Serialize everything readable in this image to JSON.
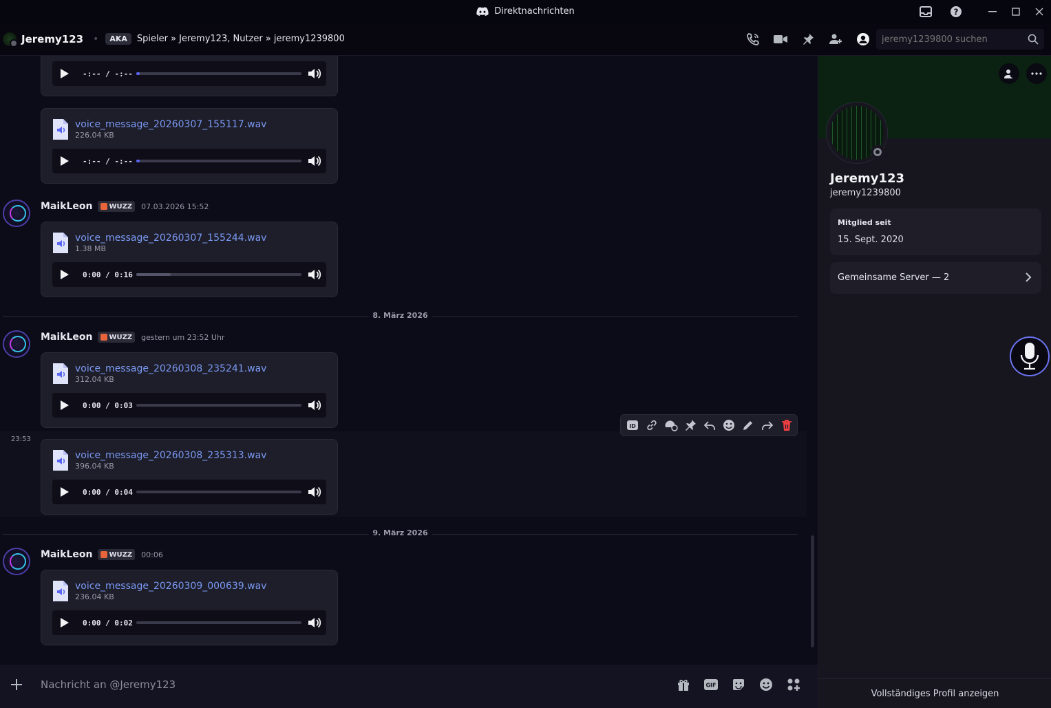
{
  "window": {
    "title": "Direktnachrichten"
  },
  "header": {
    "username": "Jeremy123",
    "aka_badge": "AKA",
    "aka_text": "Spieler » Jeremy123, Nutzer » jeremy1239800",
    "search_placeholder": "jeremy1239800 suchen"
  },
  "messages": {
    "m0": {
      "size": "",
      "time": "-:-- / -:--",
      "progress": 0.02
    },
    "m1": {
      "file": "voice_message_20260307_155117.wav",
      "size": "226.04 KB",
      "time": "-:-- / -:--",
      "progress": 0.02
    },
    "g1": {
      "author": "MaikLeon",
      "tag": "WUZZ",
      "timestamp": "07.03.2026 15:52"
    },
    "m2": {
      "file": "voice_message_20260307_155244.wav",
      "size": "1.38 MB",
      "time": "0:00 / 0:16",
      "progress": 0.0,
      "buffered": 0.21
    },
    "d1": "8. März 2026",
    "g2": {
      "author": "MaikLeon",
      "tag": "WUZZ",
      "timestamp": "gestern um 23:52 Uhr"
    },
    "m3": {
      "file": "voice_message_20260308_235241.wav",
      "size": "312.04 KB",
      "time": "0:00 / 0:03",
      "progress": 0.0
    },
    "hover_time": "23:53",
    "m4": {
      "file": "voice_message_20260308_235313.wav",
      "size": "396.04 KB",
      "time": "0:00 / 0:04",
      "progress": 0.0
    },
    "d2": "9. März 2026",
    "g3": {
      "author": "MaikLeon",
      "tag": "WUZZ",
      "timestamp": "00:06"
    },
    "m5": {
      "file": "voice_message_20260309_000639.wav",
      "size": "236.04 KB",
      "time": "0:00 / 0:02",
      "progress": 0.0
    }
  },
  "composer": {
    "placeholder": "Nachricht an @Jeremy123"
  },
  "profile": {
    "display_name": "Jeremy123",
    "username": "jeremy1239800",
    "member_since_label": "Mitglied seit",
    "member_since": "15. Sept. 2020",
    "mutual_servers": "Gemeinsame Server — 2",
    "full_profile": "Vollständiges Profil anzeigen"
  },
  "colors": {
    "accent": "#5865f2",
    "link": "#7a9af3",
    "banner": "#0b2212"
  }
}
